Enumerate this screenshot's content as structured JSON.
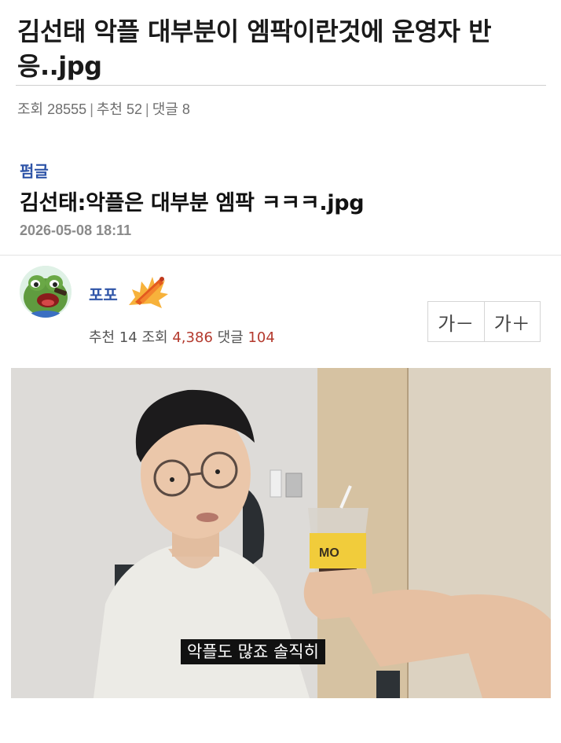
{
  "post": {
    "title": "김선태 악플 대부분이 엠팍이란것에 운영자 반응..jpg",
    "meta": {
      "views": "조회 28555",
      "likes": "추천 52",
      "comments": "댓글 8"
    }
  },
  "source": {
    "board": "펌글",
    "title": "김선태:악플은 대부분 엠팍 ㅋㅋㅋ.jpg",
    "date": "2026-05-08 18:11"
  },
  "author": {
    "name": "포포",
    "stats": {
      "likes_label": "추천",
      "likes_value": "14",
      "views_label": "조회",
      "views_value": "4,386",
      "comments_label": "댓글",
      "comments_value": "104"
    }
  },
  "font_controls": {
    "decrease": "가－",
    "increase": "가＋"
  },
  "image": {
    "caption": "악플도 많죠 솔직히",
    "cup_text": "MO"
  },
  "colors": {
    "link_blue": "#2f55a8",
    "highlight_red": "#b43a2e",
    "meta_gray": "#6e6e6e"
  }
}
